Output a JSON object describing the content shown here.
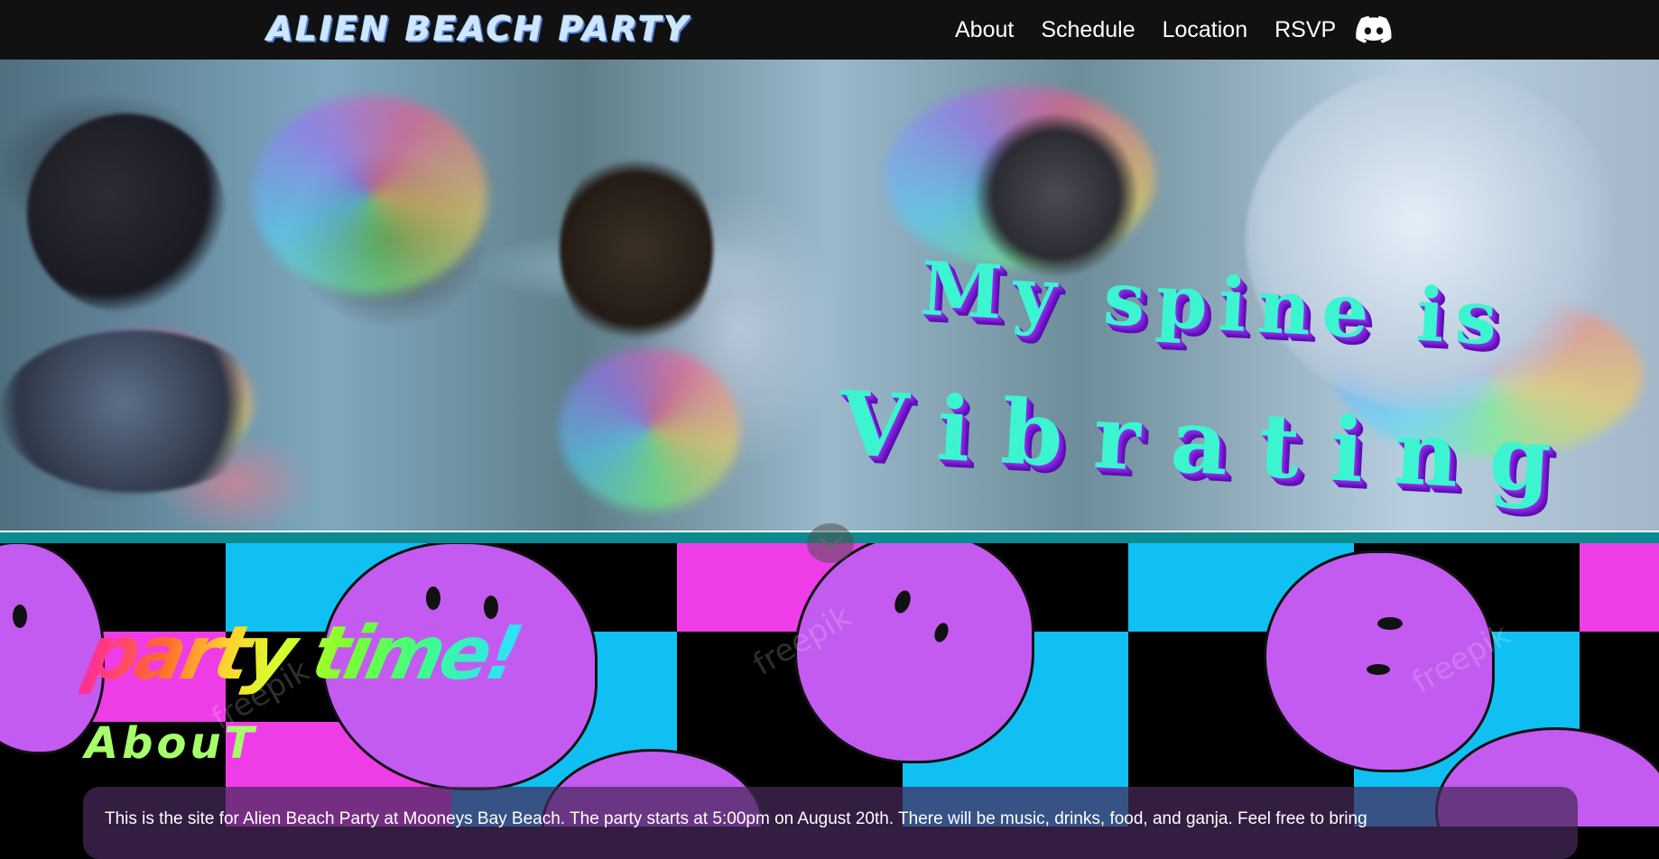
{
  "navbar": {
    "brand": "ALIEN BEACH PARTY",
    "links": [
      "About",
      "Schedule",
      "Location",
      "RSVP"
    ],
    "discord_icon": "discord-icon"
  },
  "hero": {
    "line1": "My spine is",
    "line2": "Vibrating",
    "scroll_icon": "chevron-down-icon"
  },
  "about": {
    "party_heading": "party time!",
    "section_title": "AbouT",
    "body": "This is the site for Alien Beach Party at Mooneys Bay Beach. The party starts at 5:00pm on August 20th. There will be music, drinks, food, and ganja. Feel free to bring"
  },
  "watermark": "freepik",
  "colors": {
    "nav_bg": "#111111",
    "hero_text": "#3cf5d0",
    "hero_shadow": "#8a2be2",
    "checker_pink": "#ee3de6",
    "checker_cyan": "#10c0f2",
    "blob": "#c35bf0",
    "about_title": "#a6ff6a",
    "teal_strip": "#0b8a8f"
  }
}
